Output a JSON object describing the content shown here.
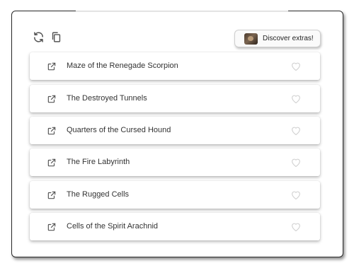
{
  "toolbar": {
    "refresh_icon": "refresh-icon",
    "copy_icon": "copy-icon",
    "extras_button": {
      "label": "Discover extras!",
      "icon": "game-thumbnail"
    }
  },
  "items": [
    {
      "title": "Maze of the Renegade Scorpion",
      "share_icon": "share-icon",
      "favorite_icon": "heart-icon"
    },
    {
      "title": "The Destroyed Tunnels",
      "share_icon": "share-icon",
      "favorite_icon": "heart-icon"
    },
    {
      "title": "Quarters of the Cursed Hound",
      "share_icon": "share-icon",
      "favorite_icon": "heart-icon"
    },
    {
      "title": "The Fire Labyrinth",
      "share_icon": "share-icon",
      "favorite_icon": "heart-icon"
    },
    {
      "title": "The Rugged Cells",
      "share_icon": "share-icon",
      "favorite_icon": "heart-icon"
    },
    {
      "title": "Cells of the Spirit Arachnid",
      "share_icon": "share-icon",
      "favorite_icon": "heart-icon"
    }
  ],
  "colors": {
    "text": "#333333",
    "icon": "#555555",
    "heart_outline": "#d0d0d0",
    "frame_border": "#2b2b2b"
  }
}
